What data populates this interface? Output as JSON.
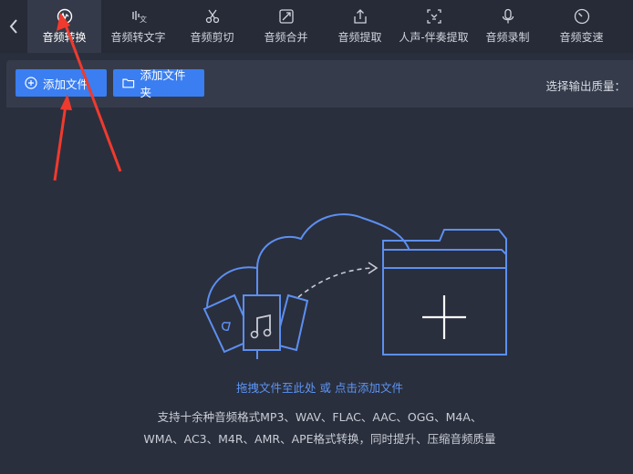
{
  "nav": {
    "tabs": [
      {
        "label": "音频转换",
        "icon": "audio-convert-icon",
        "active": true
      },
      {
        "label": "音频转文字",
        "icon": "speech-to-text-icon",
        "active": false
      },
      {
        "label": "音频剪切",
        "icon": "scissors-icon",
        "active": false
      },
      {
        "label": "音频合并",
        "icon": "merge-icon",
        "active": false
      },
      {
        "label": "音频提取",
        "icon": "extract-icon",
        "active": false
      },
      {
        "label": "人声-伴奏提取",
        "icon": "vocal-separate-icon",
        "active": false
      },
      {
        "label": "音频录制",
        "icon": "microphone-icon",
        "active": false
      },
      {
        "label": "音频变速",
        "icon": "speed-icon",
        "active": false
      }
    ]
  },
  "toolbar": {
    "add_file_label": "添加文件",
    "add_folder_label": "添加文件夹",
    "quality_label": "选择输出质量："
  },
  "drop": {
    "hint": "拖拽文件至此处 或 点击添加文件",
    "formats_line1": "支持十余种音频格式MP3、WAV、FLAC、AAC、OGG、M4A、",
    "formats_line2": "WMA、AC3、M4R、AMR、APE格式转换，同时提升、压缩音频质量"
  },
  "colors": {
    "accent": "#3a7ef2",
    "background": "#2a2f3d",
    "link": "#5c95f5",
    "annotation": "#f03a2e"
  }
}
